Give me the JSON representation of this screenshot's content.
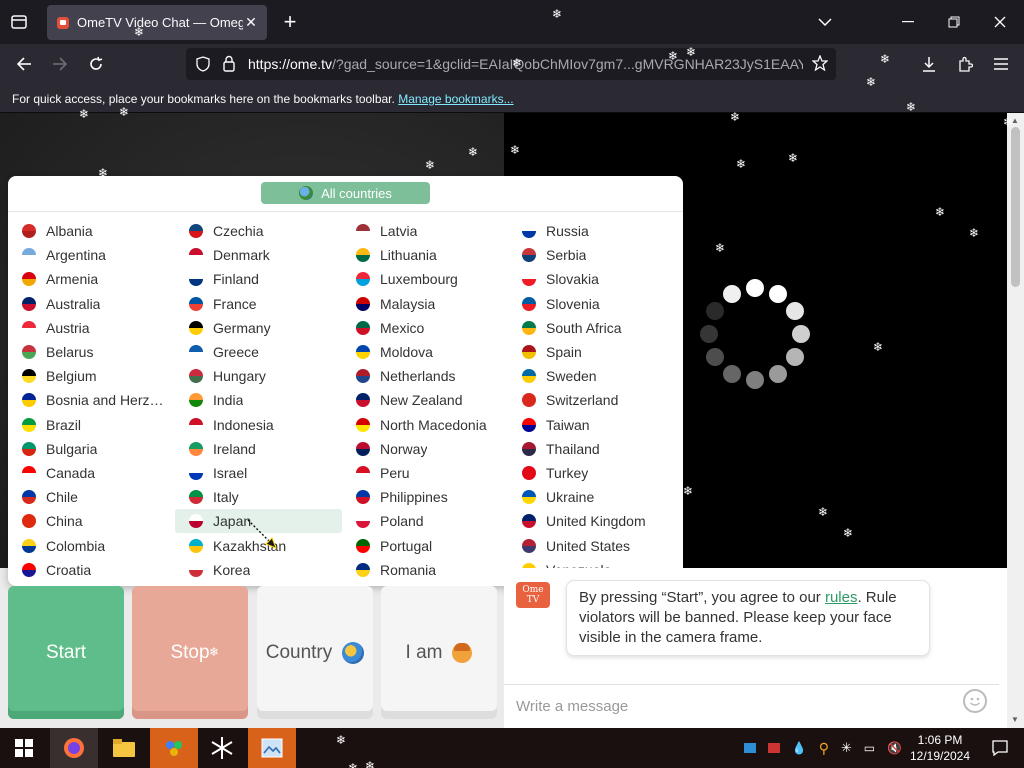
{
  "browser": {
    "tab_title": "OmeTV Video Chat — Omegle",
    "new_tab_symbol": "+",
    "url_host": "https://ome.tv",
    "url_rest": "/?gad_source=1&gclid=EAIaIQobChMIov7gm7...gMVRGNHAR23JyS1EAAY",
    "bookmarks_text": "For quick access, place your bookmarks here on the bookmarks toolbar.",
    "bookmarks_link": "Manage bookmarks..."
  },
  "panel": {
    "all_countries": "All countries",
    "columns": [
      [
        {
          "name": "Albania",
          "c1": "#d62b2b",
          "c2": "#b01e1e"
        },
        {
          "name": "Argentina",
          "c1": "#75aadb",
          "c2": "#ffffff"
        },
        {
          "name": "Armenia",
          "c1": "#d90012",
          "c2": "#f2a800"
        },
        {
          "name": "Australia",
          "c1": "#012169",
          "c2": "#c8102e"
        },
        {
          "name": "Austria",
          "c1": "#ed2939",
          "c2": "#ffffff"
        },
        {
          "name": "Belarus",
          "c1": "#c8313e",
          "c2": "#4aa657"
        },
        {
          "name": "Belgium",
          "c1": "#000000",
          "c2": "#fdda24"
        },
        {
          "name": "Bosnia and Herzeg...",
          "c1": "#002395",
          "c2": "#fecb00"
        },
        {
          "name": "Brazil",
          "c1": "#009c3b",
          "c2": "#ffdf00"
        },
        {
          "name": "Bulgaria",
          "c1": "#00966e",
          "c2": "#d62612"
        },
        {
          "name": "Canada",
          "c1": "#ff0000",
          "c2": "#ffffff"
        },
        {
          "name": "Chile",
          "c1": "#0039a6",
          "c2": "#d52b1e"
        },
        {
          "name": "China",
          "c1": "#de2910",
          "c2": "#de2910"
        },
        {
          "name": "Colombia",
          "c1": "#fcd116",
          "c2": "#003893"
        },
        {
          "name": "Croatia",
          "c1": "#ff0000",
          "c2": "#171796"
        }
      ],
      [
        {
          "name": "Czechia",
          "c1": "#11457e",
          "c2": "#d7141a"
        },
        {
          "name": "Denmark",
          "c1": "#c8102e",
          "c2": "#ffffff"
        },
        {
          "name": "Finland",
          "c1": "#ffffff",
          "c2": "#003580"
        },
        {
          "name": "France",
          "c1": "#0055a4",
          "c2": "#ef4135"
        },
        {
          "name": "Germany",
          "c1": "#000000",
          "c2": "#ffce00"
        },
        {
          "name": "Greece",
          "c1": "#0d5eaf",
          "c2": "#ffffff"
        },
        {
          "name": "Hungary",
          "c1": "#cd2a3e",
          "c2": "#436f4d"
        },
        {
          "name": "India",
          "c1": "#ff9933",
          "c2": "#138808"
        },
        {
          "name": "Indonesia",
          "c1": "#ce1126",
          "c2": "#ffffff"
        },
        {
          "name": "Ireland",
          "c1": "#169b62",
          "c2": "#ff883e"
        },
        {
          "name": "Israel",
          "c1": "#ffffff",
          "c2": "#0038b8"
        },
        {
          "name": "Italy",
          "c1": "#009246",
          "c2": "#ce2b37"
        },
        {
          "name": "Japan",
          "c1": "#ffffff",
          "c2": "#bc002d"
        },
        {
          "name": "Kazakhstan",
          "c1": "#00afca",
          "c2": "#fec50c"
        },
        {
          "name": "Korea",
          "c1": "#ffffff",
          "c2": "#cd2e3a"
        }
      ],
      [
        {
          "name": "Latvia",
          "c1": "#9e3039",
          "c2": "#ffffff"
        },
        {
          "name": "Lithuania",
          "c1": "#fdb913",
          "c2": "#006a44"
        },
        {
          "name": "Luxembourg",
          "c1": "#ed2939",
          "c2": "#00a1de"
        },
        {
          "name": "Malaysia",
          "c1": "#cc0001",
          "c2": "#010066"
        },
        {
          "name": "Mexico",
          "c1": "#006847",
          "c2": "#ce1126"
        },
        {
          "name": "Moldova",
          "c1": "#0046ae",
          "c2": "#ffd200"
        },
        {
          "name": "Netherlands",
          "c1": "#ae1c28",
          "c2": "#21468b"
        },
        {
          "name": "New Zealand",
          "c1": "#012169",
          "c2": "#c8102e"
        },
        {
          "name": "North Macedonia",
          "c1": "#d20000",
          "c2": "#ffe600"
        },
        {
          "name": "Norway",
          "c1": "#ba0c2f",
          "c2": "#00205b"
        },
        {
          "name": "Peru",
          "c1": "#d91023",
          "c2": "#ffffff"
        },
        {
          "name": "Philippines",
          "c1": "#0038a8",
          "c2": "#ce1126"
        },
        {
          "name": "Poland",
          "c1": "#ffffff",
          "c2": "#dc143c"
        },
        {
          "name": "Portugal",
          "c1": "#006600",
          "c2": "#ff0000"
        },
        {
          "name": "Romania",
          "c1": "#002b7f",
          "c2": "#fcd116"
        }
      ],
      [
        {
          "name": "Russia",
          "c1": "#ffffff",
          "c2": "#0039a6"
        },
        {
          "name": "Serbia",
          "c1": "#c6363c",
          "c2": "#0c4076"
        },
        {
          "name": "Slovakia",
          "c1": "#ffffff",
          "c2": "#ee1c25"
        },
        {
          "name": "Slovenia",
          "c1": "#005da4",
          "c2": "#ed1c24"
        },
        {
          "name": "South Africa",
          "c1": "#007a4d",
          "c2": "#ffb612"
        },
        {
          "name": "Spain",
          "c1": "#aa151b",
          "c2": "#f1bf00"
        },
        {
          "name": "Sweden",
          "c1": "#006aa7",
          "c2": "#fecc00"
        },
        {
          "name": "Switzerland",
          "c1": "#da291c",
          "c2": "#da291c"
        },
        {
          "name": "Taiwan",
          "c1": "#fe0000",
          "c2": "#000095"
        },
        {
          "name": "Thailand",
          "c1": "#a51931",
          "c2": "#2d2a4a"
        },
        {
          "name": "Turkey",
          "c1": "#e30a17",
          "c2": "#e30a17"
        },
        {
          "name": "Ukraine",
          "c1": "#0057b7",
          "c2": "#ffd700"
        },
        {
          "name": "United Kingdom",
          "c1": "#012169",
          "c2": "#c8102e"
        },
        {
          "name": "United States",
          "c1": "#b22234",
          "c2": "#3c3b6e"
        },
        {
          "name": "Venezuela",
          "c1": "#ffcc00",
          "c2": "#00247d"
        }
      ]
    ],
    "selected": "Japan"
  },
  "buttons": {
    "start": "Start",
    "stop": "Stop",
    "country": "Country",
    "iam": "I am"
  },
  "chat": {
    "logo_line1": "Ome",
    "logo_line2": "TV",
    "msg_before": "By pressing “Start”, you agree to our ",
    "msg_link": "rules",
    "msg_after": ". Rule violators will be banned. Please keep your face visible in the camera frame.",
    "input_placeholder": "Write a message"
  },
  "taskbar": {
    "time": "1:06 PM",
    "date": "12/19/2024"
  },
  "colors": {
    "start": "#5fbd8b",
    "stop": "#e8a898",
    "accent": "#7dbf98"
  }
}
